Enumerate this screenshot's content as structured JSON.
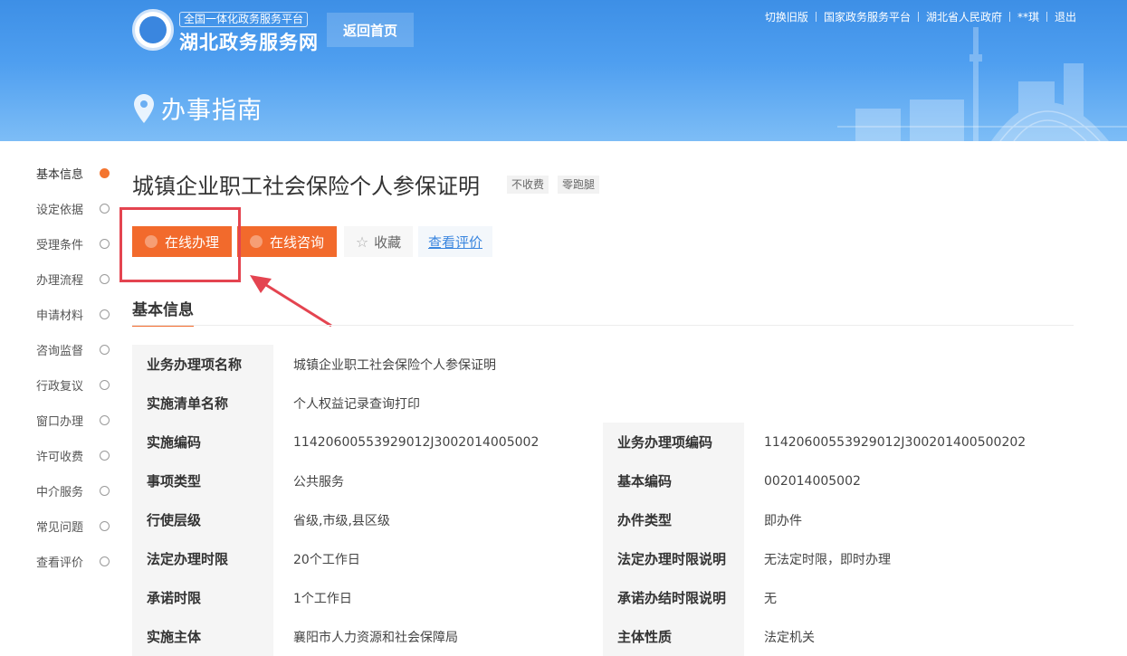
{
  "header": {
    "logo_subtitle": "全国一体化政务服务平台",
    "logo_title": "湖北政务服务网",
    "back_home": "返回首页",
    "top_links": [
      "切换旧版",
      "国家政务服务平台",
      "湖北省人民政府",
      "**琪",
      "退出"
    ],
    "page_title": "办事指南"
  },
  "sidenav": {
    "items": [
      {
        "label": "基本信息",
        "active": true
      },
      {
        "label": "设定依据",
        "active": false
      },
      {
        "label": "受理条件",
        "active": false
      },
      {
        "label": "办理流程",
        "active": false
      },
      {
        "label": "申请材料",
        "active": false
      },
      {
        "label": "咨询监督",
        "active": false
      },
      {
        "label": "行政复议",
        "active": false
      },
      {
        "label": "窗口办理",
        "active": false
      },
      {
        "label": "许可收费",
        "active": false
      },
      {
        "label": "中介服务",
        "active": false
      },
      {
        "label": "常见问题",
        "active": false
      },
      {
        "label": "查看评价",
        "active": false
      }
    ]
  },
  "service": {
    "title": "城镇企业职工社会保险个人参保证明",
    "tags": [
      "不收费",
      "零跑腿"
    ]
  },
  "actions": {
    "online": "在线办理",
    "consult": "在线咨询",
    "favorite": "收藏",
    "review": "查看评价"
  },
  "basic_info": {
    "heading": "基本信息",
    "rows": [
      {
        "l1": "业务办理项名称",
        "v1": "城镇企业职工社会保险个人参保证明",
        "l2": "",
        "v2": ""
      },
      {
        "l1": "实施清单名称",
        "v1": "个人权益记录查询打印",
        "l2": "",
        "v2": ""
      },
      {
        "l1": "实施编码",
        "v1": "11420600553929012J3002014005002",
        "l2": "业务办理项编码",
        "v2": "11420600553929012J300201400500202"
      },
      {
        "l1": "事项类型",
        "v1": "公共服务",
        "l2": "基本编码",
        "v2": "002014005002"
      },
      {
        "l1": "行使层级",
        "v1": "省级,市级,县区级",
        "l2": "办件类型",
        "v2": "即办件"
      },
      {
        "l1": "法定办理时限",
        "v1": "20个工作日",
        "l2": "法定办理时限说明",
        "v2": "无法定时限，即时办理"
      },
      {
        "l1": "承诺时限",
        "v1": "1个工作日",
        "l2": "承诺办结时限说明",
        "v2": "无"
      },
      {
        "l1": "实施主体",
        "v1": "襄阳市人力资源和社会保障局",
        "l2": "主体性质",
        "v2": "法定机关"
      }
    ]
  },
  "colors": {
    "accent_orange": "#f26a2c",
    "highlight_red": "#e44450",
    "link_blue": "#3a86df",
    "banner_blue": "#4f9ff0"
  }
}
